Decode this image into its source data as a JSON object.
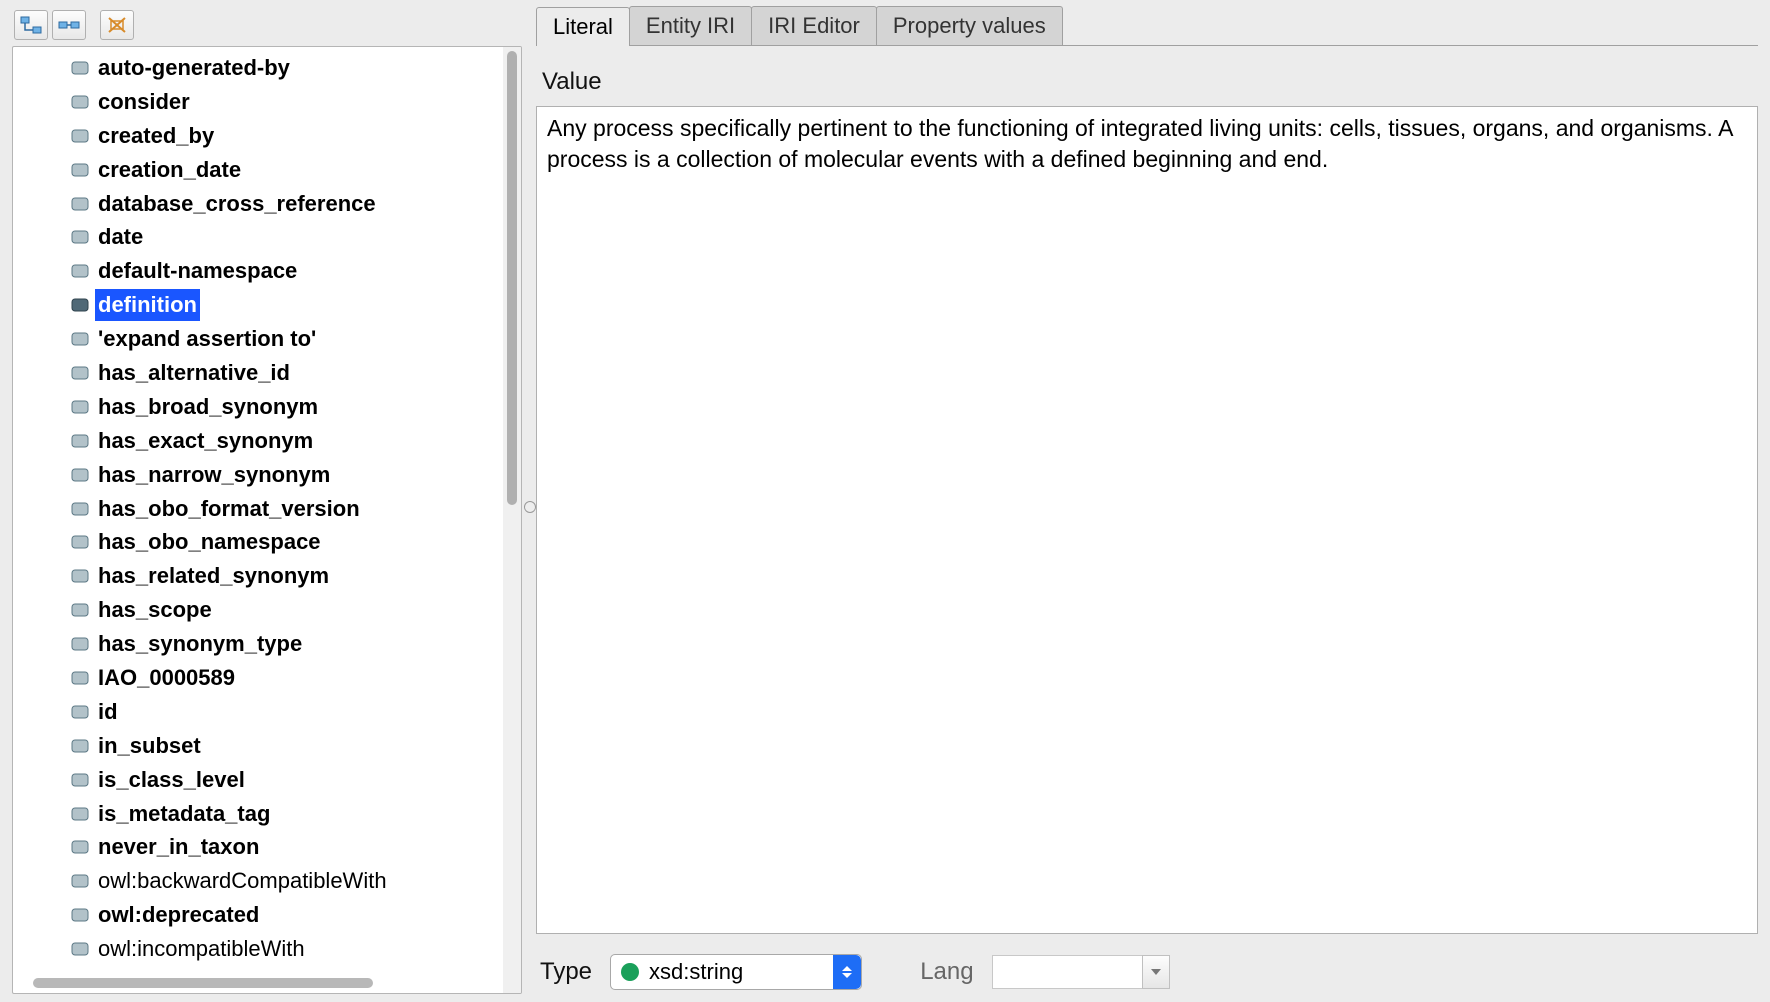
{
  "sidebar": {
    "items": [
      {
        "label": "auto-generated-by",
        "bold": true
      },
      {
        "label": "consider",
        "bold": true
      },
      {
        "label": "created_by",
        "bold": true
      },
      {
        "label": "creation_date",
        "bold": true
      },
      {
        "label": "database_cross_reference",
        "bold": true
      },
      {
        "label": "date",
        "bold": true
      },
      {
        "label": "default-namespace",
        "bold": true
      },
      {
        "label": "definition",
        "bold": true,
        "selected": true
      },
      {
        "label": "'expand assertion to'",
        "bold": true
      },
      {
        "label": "has_alternative_id",
        "bold": true
      },
      {
        "label": "has_broad_synonym",
        "bold": true
      },
      {
        "label": "has_exact_synonym",
        "bold": true
      },
      {
        "label": "has_narrow_synonym",
        "bold": true
      },
      {
        "label": "has_obo_format_version",
        "bold": true
      },
      {
        "label": "has_obo_namespace",
        "bold": true
      },
      {
        "label": "has_related_synonym",
        "bold": true
      },
      {
        "label": "has_scope",
        "bold": true
      },
      {
        "label": "has_synonym_type",
        "bold": true
      },
      {
        "label": "IAO_0000589",
        "bold": true
      },
      {
        "label": "id",
        "bold": true
      },
      {
        "label": "in_subset",
        "bold": true
      },
      {
        "label": "is_class_level",
        "bold": true
      },
      {
        "label": "is_metadata_tag",
        "bold": true
      },
      {
        "label": "never_in_taxon",
        "bold": true
      },
      {
        "label": "owl:backwardCompatibleWith",
        "bold": false
      },
      {
        "label": "owl:deprecated",
        "bold": true
      },
      {
        "label": "owl:incompatibleWith",
        "bold": false
      }
    ]
  },
  "tabs": [
    {
      "label": "Literal",
      "active": true
    },
    {
      "label": "Entity IRI",
      "active": false
    },
    {
      "label": "IRI Editor",
      "active": false
    },
    {
      "label": "Property values",
      "active": false
    }
  ],
  "editor": {
    "value_label": "Value",
    "value_text": "Any process specifically pertinent to the functioning of integrated living units: cells, tissues, organs, and organisms. A process is a collection of molecular events with a defined beginning and end.",
    "type_label": "Type",
    "type_value": "xsd:string",
    "lang_label": "Lang",
    "lang_value": ""
  }
}
